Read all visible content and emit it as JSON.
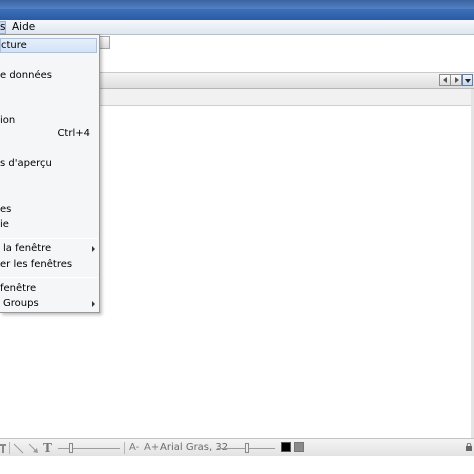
{
  "menubar": {
    "items": [
      {
        "label": "s"
      },
      {
        "label": "Aide"
      }
    ]
  },
  "dropdown": {
    "items": [
      {
        "label": "cture",
        "shortcut": "",
        "submenu": false
      },
      {
        "label": "e données",
        "shortcut": "",
        "submenu": false
      },
      {
        "label": "ion",
        "shortcut": "",
        "submenu": false
      },
      {
        "label": "",
        "shortcut": "Ctrl+4",
        "submenu": false
      },
      {
        "label": "s d'aperçu",
        "shortcut": "",
        "submenu": false
      },
      {
        "label": "es",
        "shortcut": "",
        "submenu": false
      },
      {
        "label": "ie",
        "shortcut": "",
        "submenu": false
      },
      {
        "label": "la fenêtre",
        "shortcut": "",
        "submenu": true
      },
      {
        "label": "er les fenêtres",
        "shortcut": "",
        "submenu": false
      },
      {
        "label": "fenêtre",
        "shortcut": "",
        "submenu": false
      },
      {
        "label": "Groups",
        "shortcut": "",
        "submenu": true
      }
    ]
  },
  "statusbar": {
    "font_name": "Arial Gras, 32",
    "text_glyph": "T",
    "font_small_glyph": "A-",
    "font_large_glyph": "A+"
  },
  "colors": {
    "titlebar": "#2a5aa4",
    "menu_highlight": "#d2e3f8",
    "foreground_swatch": "#000000",
    "background_swatch": "#8a8a8a"
  }
}
